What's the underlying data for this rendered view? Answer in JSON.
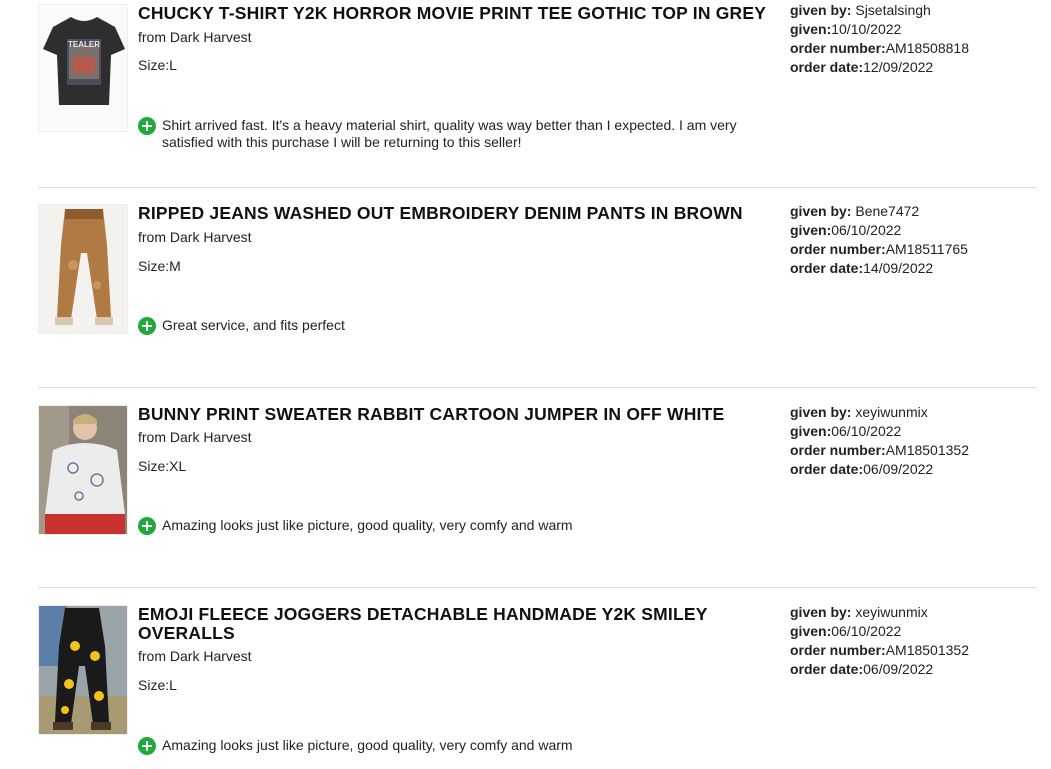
{
  "reviews": [
    {
      "title": "CHUCKY T-SHIRT Y2K HORROR MOVIE PRINT TEE GOTHIC TOP IN GREY",
      "store": "from Dark Harvest",
      "size": "Size:L",
      "comment": "Shirt arrived fast. It's a heavy material shirt, quality was way better than I expected. I am very satisfied with this purchase I will be returning to this seller!",
      "meta": {
        "given_by_label": "given by:",
        "given_by": " Sjsetalsingh",
        "given_label": "given:",
        "given": "10/10/2022",
        "order_number_label": "order number:",
        "order_number": "AM18508818",
        "order_date_label": "order date:",
        "order_date": "12/09/2022"
      },
      "image_label": "TEALER"
    },
    {
      "title": "RIPPED JEANS WASHED OUT EMBROIDERY DENIM PANTS IN BROWN",
      "store": "from Dark Harvest",
      "size": "Size:M",
      "comment": "Great service, and fits perfect",
      "meta": {
        "given_by_label": "given by:",
        "given_by": " Bene7472",
        "given_label": "given:",
        "given": "06/10/2022",
        "order_number_label": "order number:",
        "order_number": "AM18511765",
        "order_date_label": "order date:",
        "order_date": "14/09/2022"
      }
    },
    {
      "title": "BUNNY PRINT SWEATER RABBIT CARTOON JUMPER IN OFF WHITE",
      "store": "from Dark Harvest",
      "size": "Size:XL",
      "comment": "Amazing looks just like picture, good quality, very comfy and warm",
      "meta": {
        "given_by_label": "given by:",
        "given_by": " xeyiwunmix",
        "given_label": "given:",
        "given": "06/10/2022",
        "order_number_label": "order number:",
        "order_number": "AM18501352",
        "order_date_label": "order date:",
        "order_date": "06/09/2022"
      }
    },
    {
      "title": "EMOJI FLEECE JOGGERS DETACHABLE HANDMADE Y2K SMILEY OVERALLS",
      "store": "from Dark Harvest",
      "size": "Size:L",
      "comment": "Amazing looks just like picture, good quality, very comfy and warm",
      "meta": {
        "given_by_label": "given by:",
        "given_by": " xeyiwunmix",
        "given_label": "given:",
        "given": "06/10/2022",
        "order_number_label": "order number:",
        "order_number": "AM18501352",
        "order_date_label": "order date:",
        "order_date": "06/09/2022"
      }
    }
  ],
  "colors": {
    "plus_icon": "#1faa3b",
    "separator": "#d9d9d9",
    "title": "#111111"
  },
  "icons": [
    "plus-circle-icon"
  ]
}
